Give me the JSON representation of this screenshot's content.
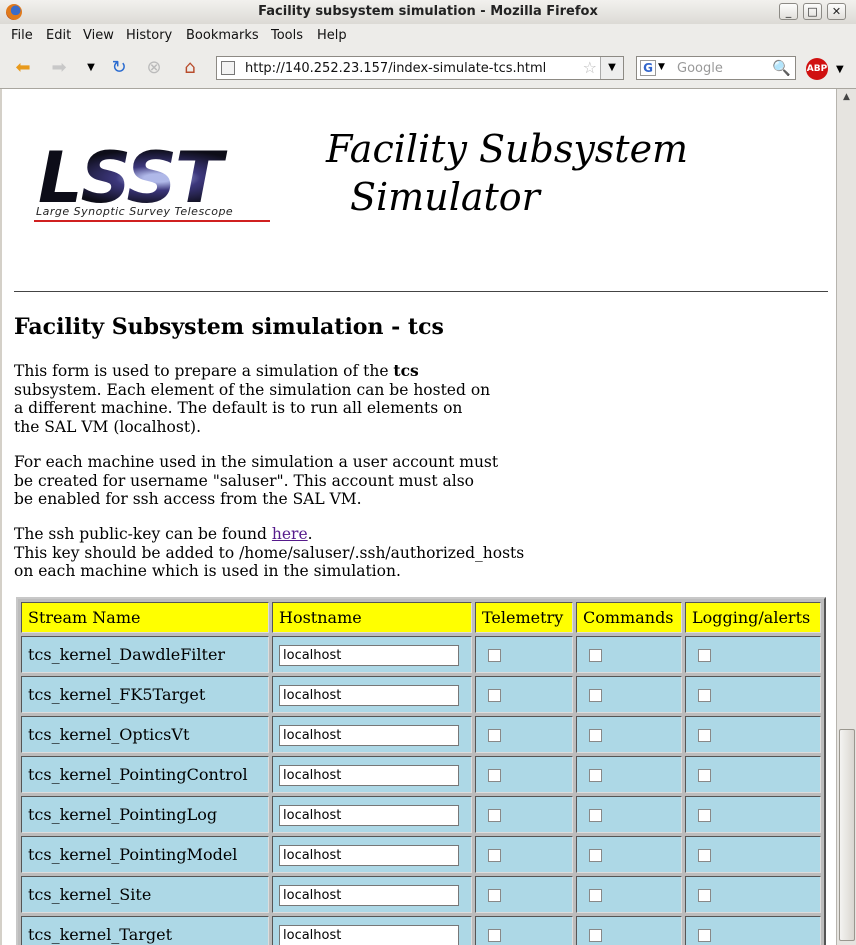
{
  "window": {
    "title": "Facility subsystem simulation - Mozilla Firefox",
    "controls": {
      "minimize": "_",
      "maximize": "□",
      "close": "✕"
    }
  },
  "menubar": [
    "File",
    "Edit",
    "View",
    "History",
    "Bookmarks",
    "Tools",
    "Help"
  ],
  "toolbar": {
    "url": "http://140.252.23.157/index-simulate-tcs.html",
    "search_engine": "G",
    "search_placeholder": "Google",
    "adblock_label": "ABP"
  },
  "header": {
    "logo_word": "LSST",
    "logo_subtitle": "Large Synoptic Survey Telescope",
    "simulator_title_line1": "Facility Subsystem",
    "simulator_title_line2": "Simulator"
  },
  "main": {
    "heading": "Facility Subsystem simulation - tcs",
    "intro": {
      "l1_before": "This form is used to prepare a simulation of the ",
      "l1_bold": "tcs",
      "l2": "subsystem. Each element of the simulation can be hosted on",
      "l3": "a different machine. The default is to run all elements on",
      "l4": "the SAL VM (localhost)."
    },
    "account": {
      "l1": "For each machine used in the simulation a user account must",
      "l2": "be created for username \"saluser\". This account must also",
      "l3": "be enabled for ssh access from the SAL VM."
    },
    "sshkey": {
      "l1_before": "The ssh public-key can be found ",
      "l1_link": "here",
      "l1_after": ".",
      "l2": "This key should be added to /home/saluser/.ssh/authorized_hosts",
      "l3": "on each machine which is used in the simulation."
    }
  },
  "table": {
    "headers": [
      "Stream Name",
      "Hostname",
      "Telemetry",
      "Commands",
      "Logging/alerts"
    ],
    "rows": [
      {
        "stream": "tcs_kernel_DawdleFilter",
        "hostname": "localhost"
      },
      {
        "stream": "tcs_kernel_FK5Target",
        "hostname": "localhost"
      },
      {
        "stream": "tcs_kernel_OpticsVt",
        "hostname": "localhost"
      },
      {
        "stream": "tcs_kernel_PointingControl",
        "hostname": "localhost"
      },
      {
        "stream": "tcs_kernel_PointingLog",
        "hostname": "localhost"
      },
      {
        "stream": "tcs_kernel_PointingModel",
        "hostname": "localhost"
      },
      {
        "stream": "tcs_kernel_Site",
        "hostname": "localhost"
      },
      {
        "stream": "tcs_kernel_Target",
        "hostname": "localhost"
      }
    ]
  }
}
